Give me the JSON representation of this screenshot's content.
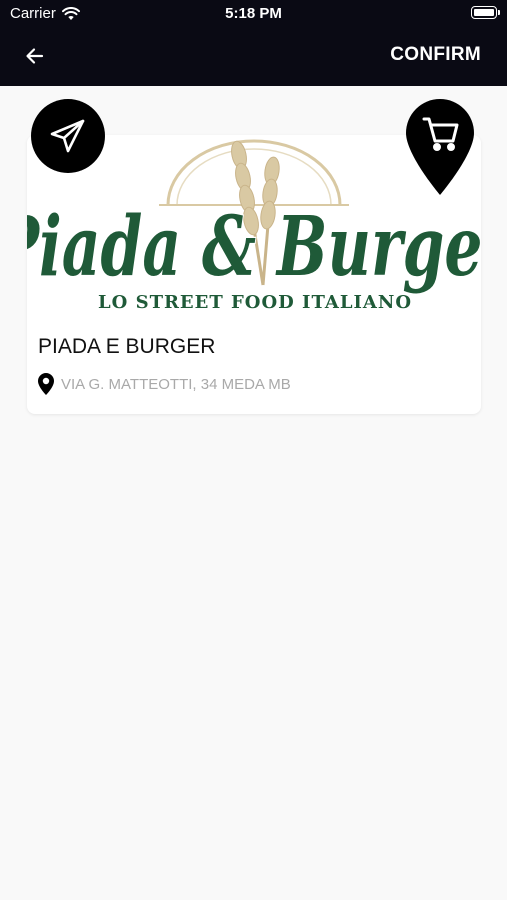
{
  "status_bar": {
    "carrier": "Carrier",
    "time": "5:18 PM"
  },
  "nav": {
    "confirm_label": "CONFIRM"
  },
  "restaurant": {
    "logo_name": "Piada & Burger",
    "logo_tagline": "LO STREET FOOD ITALIANO",
    "name": "PIADA E BURGER",
    "address": "VIA G. MATTEOTTI, 34 MEDA MB"
  },
  "colors": {
    "topbar": "#0a0a14",
    "logo_green": "#1f5a38",
    "wheat": "#d9c9a3"
  },
  "icons": {
    "back": "arrow-left-icon",
    "send": "paper-plane-icon",
    "cart": "cart-icon",
    "location": "location-pin-icon"
  }
}
